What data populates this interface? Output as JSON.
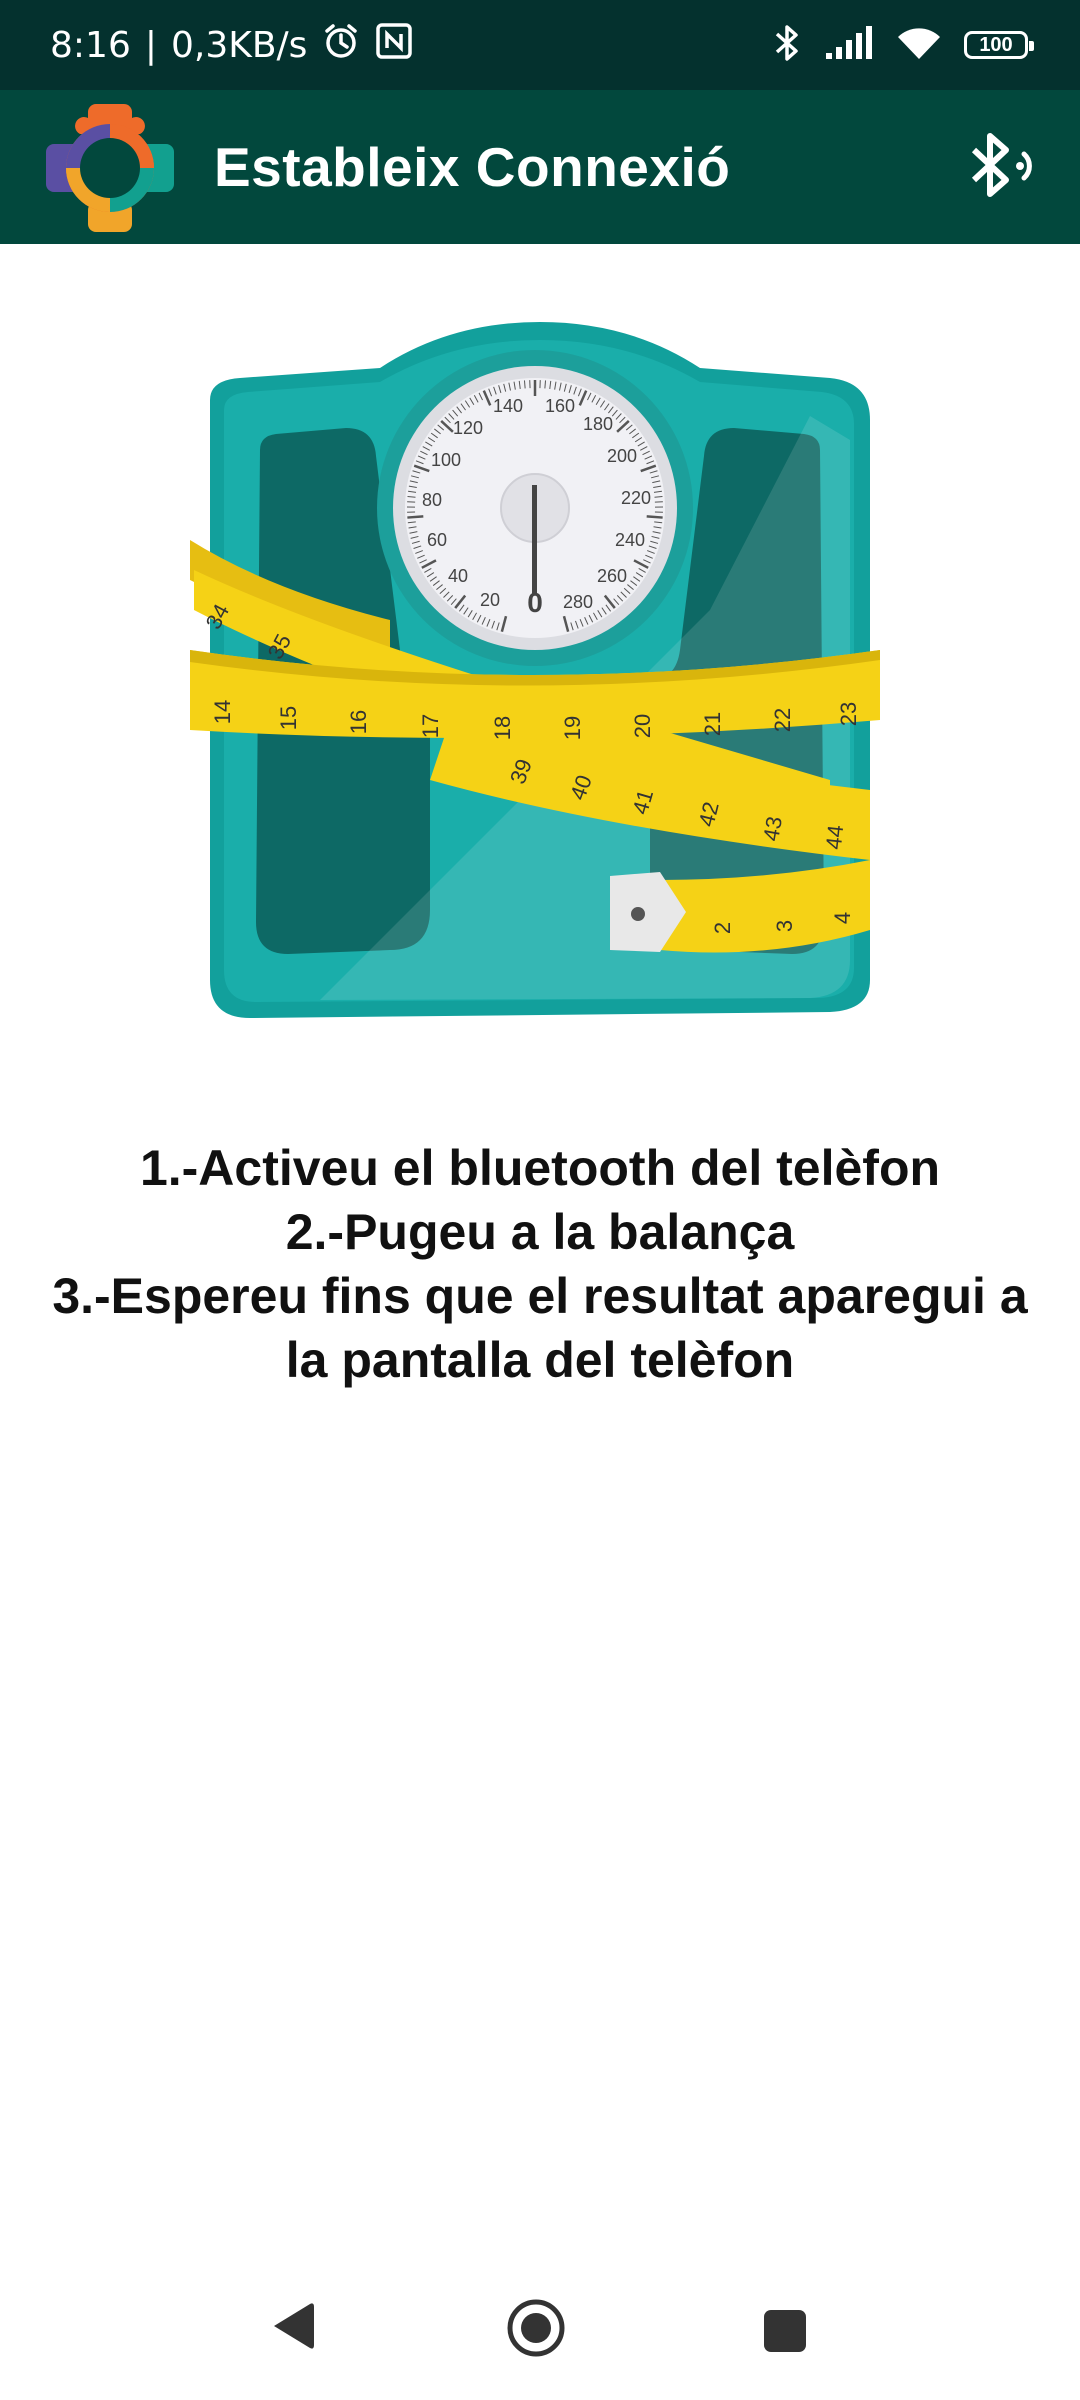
{
  "status_bar": {
    "time": "8:16",
    "separator": "|",
    "network_speed": "0,3KB/s",
    "battery_level": "100",
    "icons": [
      "alarm-icon",
      "nfc-icon",
      "bluetooth-icon",
      "signal-icon",
      "wifi-icon",
      "battery-icon"
    ]
  },
  "app_bar": {
    "title": "Estableix Connexió",
    "logo_icon": "app-logo-icon",
    "action_icon": "bluetooth-searching-icon"
  },
  "illustration": {
    "icon": "bathroom-scale-with-tape-measure",
    "dial_labels": [
      "0",
      "20",
      "40",
      "60",
      "80",
      "100",
      "120",
      "140",
      "160",
      "180",
      "200",
      "220",
      "240",
      "260",
      "280"
    ],
    "tape_labels": [
      "14",
      "15",
      "16",
      "17",
      "18",
      "19",
      "20",
      "21",
      "22",
      "23"
    ],
    "tape_labels_lower": [
      "34",
      "35",
      "39",
      "40",
      "41",
      "42",
      "43",
      "44"
    ],
    "tape_labels_tail": [
      "2",
      "3",
      "4"
    ]
  },
  "instructions": {
    "line1": "1.-Activeu el bluetooth del telèfon",
    "line2": "2.-Pugeu a la balança",
    "line3": "3.-Espereu fins que el resultat aparegui a",
    "line4": "la pantalla del telèfon"
  },
  "nav_bar": {
    "icons": [
      "back-icon",
      "home-icon",
      "recents-icon"
    ]
  },
  "colors": {
    "status_bar": "#04312e",
    "app_bar": "#02483d",
    "scale_teal": "#12a09c",
    "tape_yellow": "#f5d216",
    "text": "#111111"
  }
}
